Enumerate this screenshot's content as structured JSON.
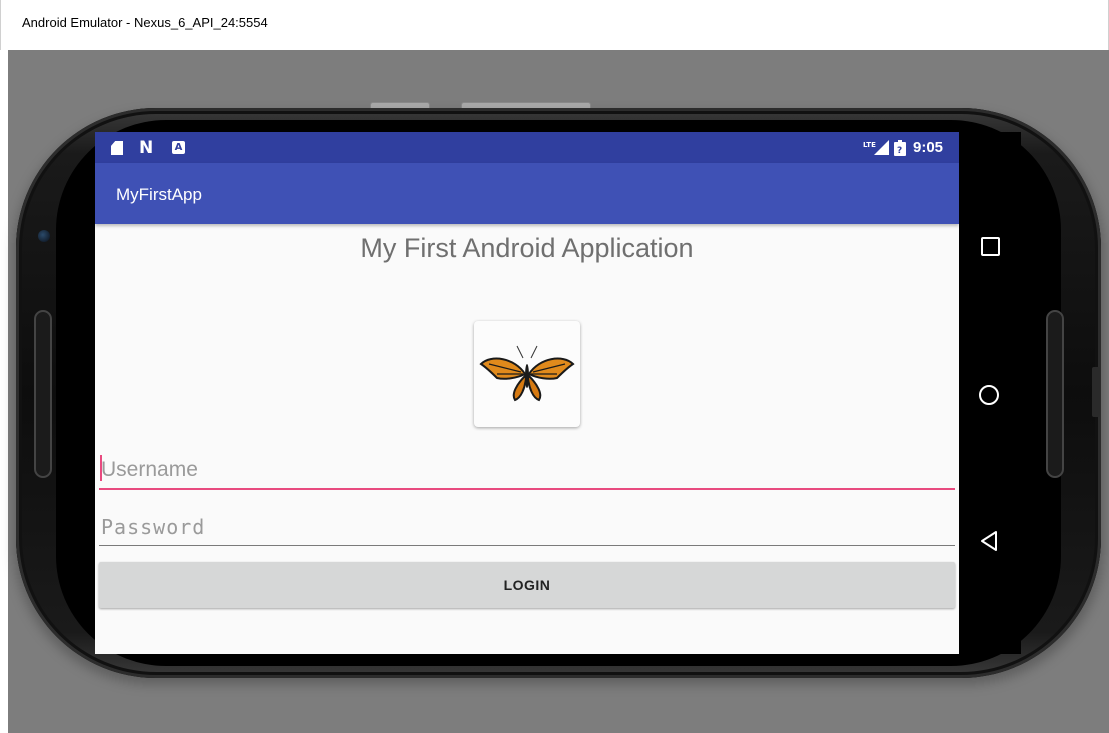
{
  "window": {
    "title": "Android Emulator - Nexus_6_API_24:5554"
  },
  "status_bar": {
    "icons": [
      "sd-card-icon",
      "n-notification-icon",
      "a-notification-icon",
      "lte-signal-icon",
      "battery-icon"
    ],
    "network_label": "LTE",
    "time": "9:05"
  },
  "app_bar": {
    "title": "MyFirstApp"
  },
  "main": {
    "heading": "My First Android Application",
    "image_button": {
      "icon": "butterfly-icon"
    },
    "username": {
      "placeholder": "Username",
      "value": ""
    },
    "password": {
      "placeholder": "Password",
      "value": ""
    },
    "login_label": "LOGIN"
  },
  "nav_bar": {
    "items": [
      "recents-square-icon",
      "home-circle-icon",
      "back-triangle-icon"
    ]
  },
  "colors": {
    "status_bar": "#303f9f",
    "app_bar": "#3f51b5",
    "accent": "#e84a7f",
    "button": "#d6d7d7"
  }
}
